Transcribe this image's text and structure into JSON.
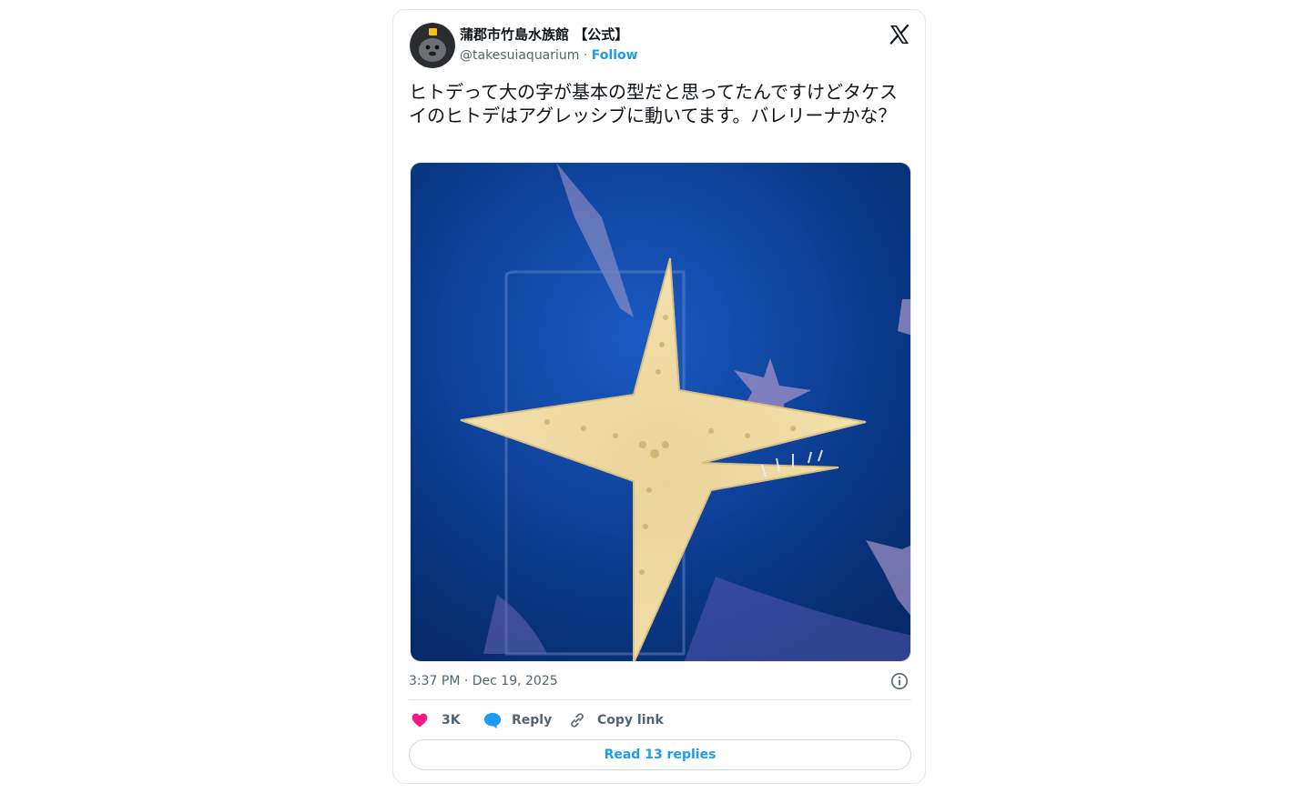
{
  "tweet": {
    "display_name": "蒲郡市竹島水族館 【公式】",
    "handle": "@takesuiaquarium",
    "separator": "·",
    "follow_label": "Follow",
    "text": "ヒトデって大の字が基本の型だと思ってたんですけどタケスイのヒトデはアグレッシブに動いてます。バレリーナかな？",
    "timestamp": "3:37 PM · Dec 19, 2025",
    "likes_count": "3K",
    "reply_label": "Reply",
    "copy_link_label": "Copy link",
    "read_replies_label": "Read 13 replies"
  },
  "icons": {
    "brand": "x-logo-icon",
    "info": "info-icon",
    "like": "heart-icon",
    "reply": "reply-bubble-icon",
    "copy": "link-icon"
  },
  "colors": {
    "like": "#f91880",
    "reply": "#1d9bf0",
    "link": "#1d9bf0",
    "text": "#0f1419",
    "muted": "#536471",
    "water": "#0b3c8f"
  }
}
